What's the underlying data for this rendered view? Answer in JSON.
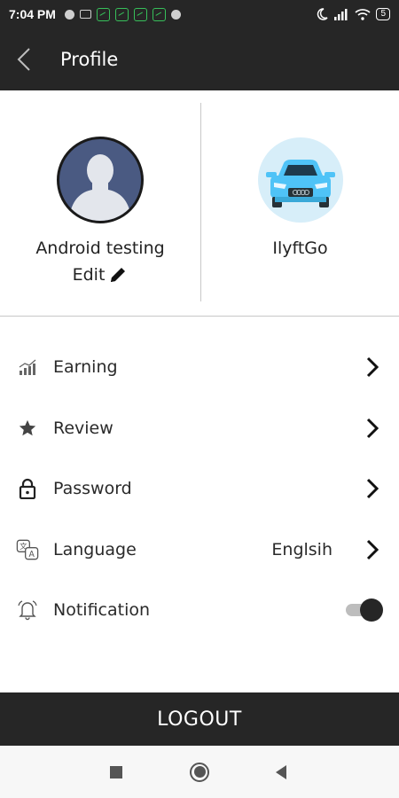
{
  "status_bar": {
    "time": "7:04 PM",
    "battery": "5"
  },
  "header": {
    "title": "Profile",
    "back_icon": "chevron-left-icon"
  },
  "profile": {
    "user_name": "Android testing",
    "edit_label": "Edit",
    "brand_name": "IlyftGo"
  },
  "menu": {
    "items": [
      {
        "label": "Earning",
        "icon": "chart-icon"
      },
      {
        "label": "Review",
        "icon": "star-icon"
      },
      {
        "label": "Password",
        "icon": "lock-icon"
      },
      {
        "label": "Language",
        "icon": "translate-icon",
        "value": "Englsih"
      },
      {
        "label": "Notification",
        "icon": "bell-icon",
        "toggle_on": true
      }
    ]
  },
  "logout_label": "LOGOUT",
  "colors": {
    "bar_dark": "#262626",
    "accent_car": "#4fc3f7",
    "avatar_bg": "#4a5a82"
  }
}
